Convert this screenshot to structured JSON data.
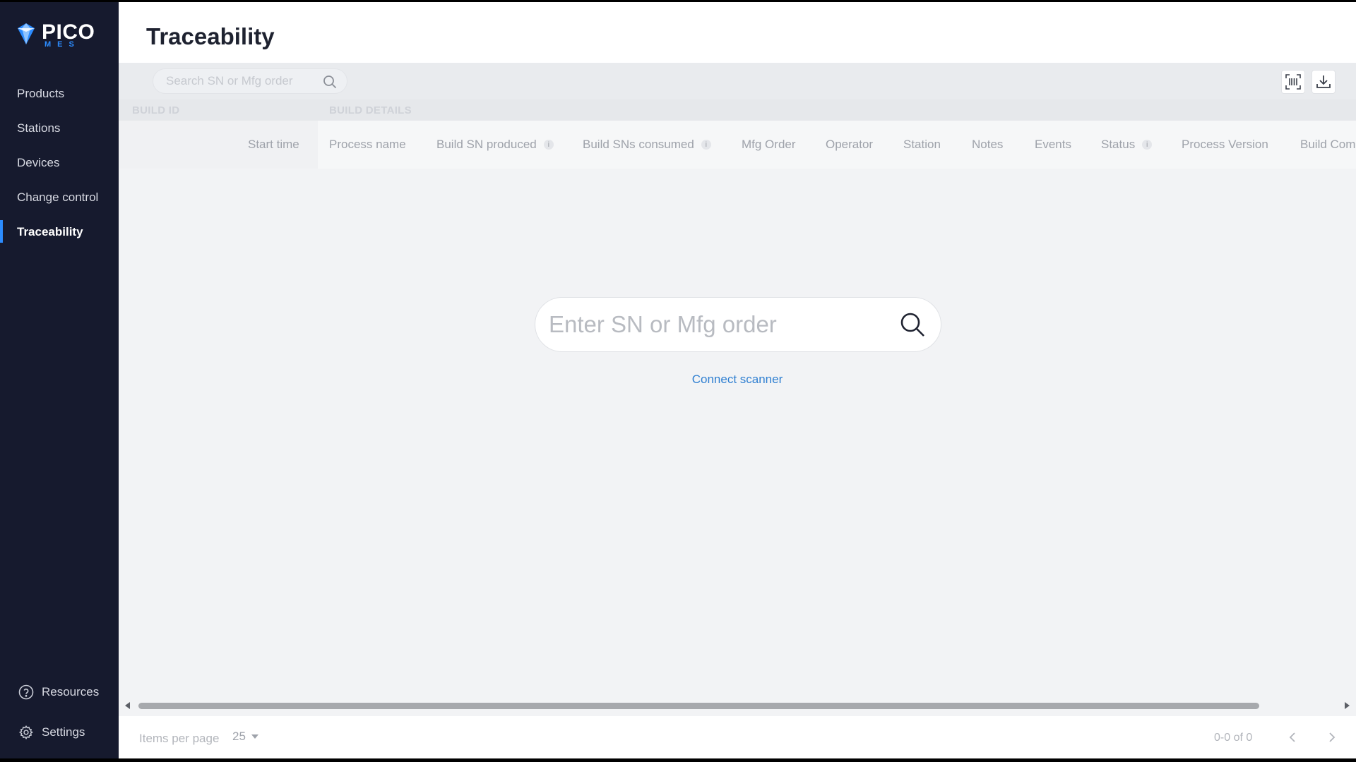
{
  "app": {
    "logo_main": "PICO",
    "logo_sub": "MES"
  },
  "sidebar": {
    "items": [
      {
        "label": "Products"
      },
      {
        "label": "Stations"
      },
      {
        "label": "Devices"
      },
      {
        "label": "Change control"
      },
      {
        "label": "Traceability",
        "active": true
      }
    ],
    "bottom": [
      {
        "label": "Resources",
        "icon": "help-circle-icon"
      },
      {
        "label": "Settings",
        "icon": "gear-icon"
      }
    ]
  },
  "header": {
    "title": "Traceability"
  },
  "toolbar": {
    "search_placeholder": "Search SN or Mfg order",
    "icons": [
      "barcode-scan-icon",
      "download-icon"
    ]
  },
  "table": {
    "groups": [
      "BUILD ID",
      "BUILD DETAILS"
    ],
    "columns": [
      {
        "label": "Start time"
      },
      {
        "label": "Process name"
      },
      {
        "label": "Build SN produced",
        "info": true
      },
      {
        "label": "Build SNs consumed",
        "info": true
      },
      {
        "label": "Mfg Order"
      },
      {
        "label": "Operator"
      },
      {
        "label": "Station"
      },
      {
        "label": "Notes"
      },
      {
        "label": "Events"
      },
      {
        "label": "Status",
        "info": true
      },
      {
        "label": "Process Version"
      },
      {
        "label": "Build Com"
      }
    ]
  },
  "center": {
    "search_placeholder": "Enter SN or Mfg order",
    "connect_label": "Connect scanner"
  },
  "footer": {
    "items_per_page_label": "Items per page",
    "items_per_page_value": "25",
    "range": "0-0 of 0"
  },
  "colors": {
    "sidebar_bg": "#161a2e",
    "accent": "#2c8cff",
    "link": "#2f7fd1"
  }
}
